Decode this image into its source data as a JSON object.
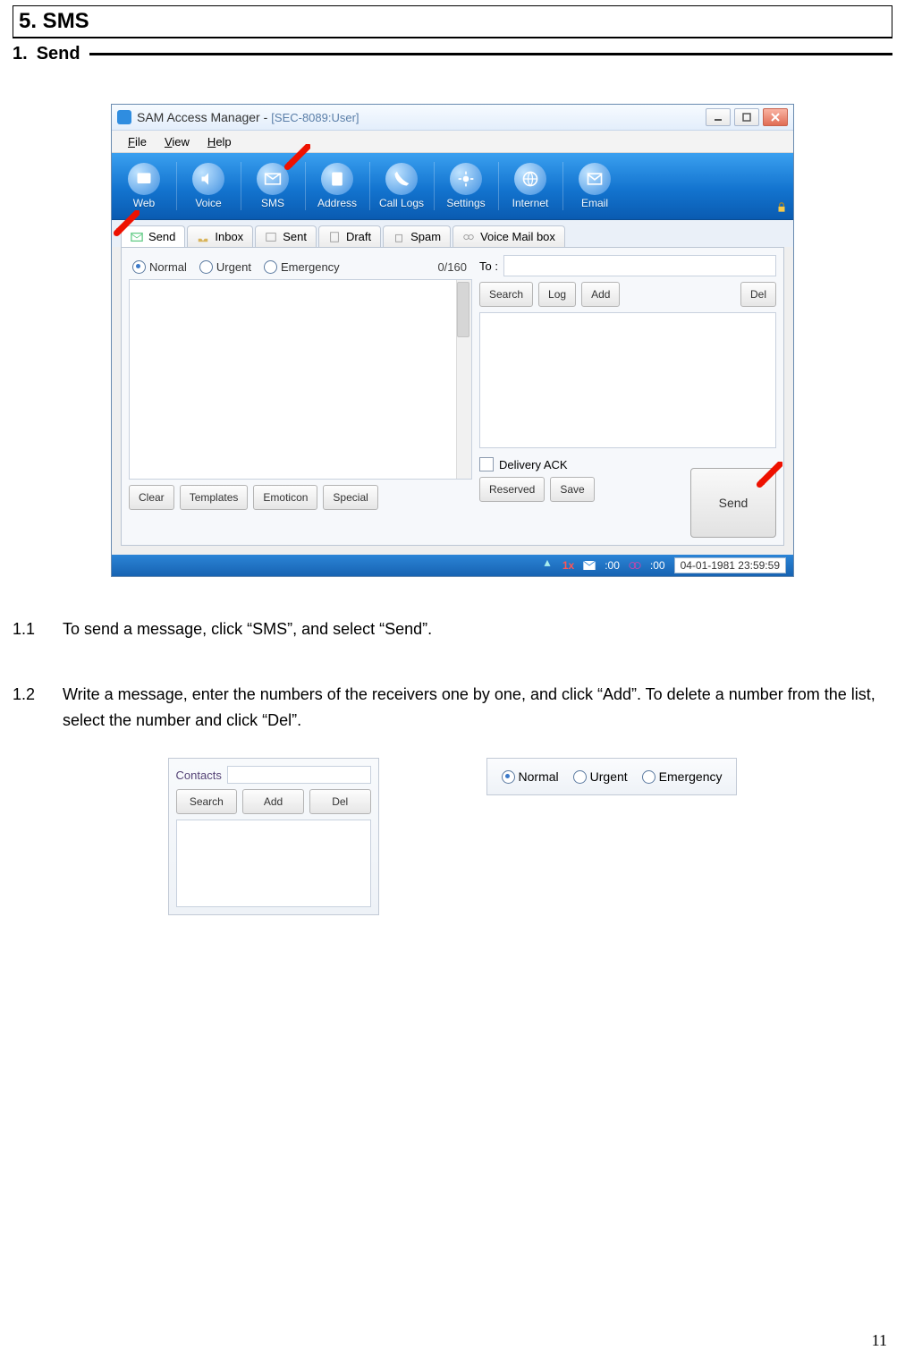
{
  "section_title": "5. SMS",
  "subsection_num": "1.",
  "subsection_title": "Send",
  "page_number": "11",
  "window": {
    "title_app": "SAM Access Manager -",
    "title_sub": "[SEC-8089:User]",
    "menus": {
      "file": "File",
      "view": "View",
      "help": "Help"
    },
    "toolbar": {
      "web": "Web",
      "voice": "Voice",
      "sms": "SMS",
      "address": "Address",
      "call_logs": "Call Logs",
      "settings": "Settings",
      "internet": "Internet",
      "email": "Email"
    },
    "tabs": {
      "send": "Send",
      "inbox": "Inbox",
      "sent": "Sent",
      "draft": "Draft",
      "spam": "Spam",
      "voice_mail": "Voice Mail box"
    },
    "priority": {
      "normal": "Normal",
      "urgent": "Urgent",
      "emergency": "Emergency"
    },
    "counter": "0/160",
    "buttons": {
      "clear": "Clear",
      "templates": "Templates",
      "emoticon": "Emoticon",
      "special": "Special",
      "search": "Search",
      "log": "Log",
      "add": "Add",
      "del": "Del",
      "reserved": "Reserved",
      "save": "Save",
      "send": "Send"
    },
    "to_label": "To :",
    "delivery_ack": "Delivery ACK",
    "status": {
      "sig": "1x",
      "m1": ":00",
      "m2": ":00",
      "clock": "04-01-1981 23:59:59"
    }
  },
  "steps": {
    "s1_num": "1.1",
    "s1_text": "To send a message, click “SMS”, and select “Send”.",
    "s2_num": "1.2",
    "s2_text": "Write a message, enter the numbers of the receivers one by one, and click “Add”. To delete a number from the list, select the number and click “Del”."
  },
  "contacts_panel": {
    "label": "Contacts",
    "search": "Search",
    "add": "Add",
    "del": "Del"
  },
  "prio2": {
    "normal": "Normal",
    "urgent": "Urgent",
    "emergency": "Emergency"
  }
}
